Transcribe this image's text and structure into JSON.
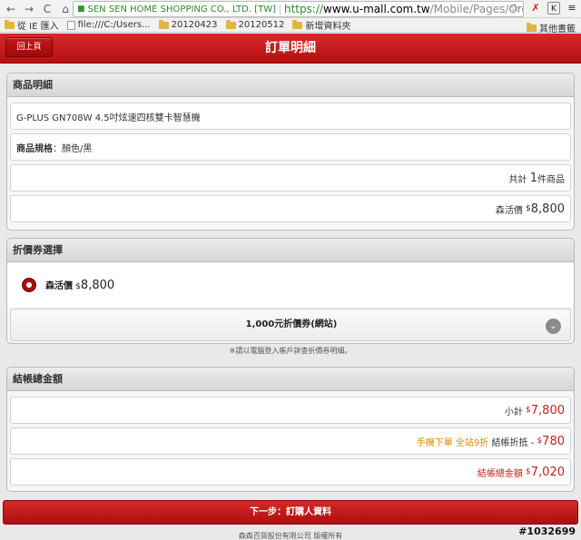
{
  "browser": {
    "ev_badge": "SEN SEN HOME SHOPPING CO., LTD. [TW]",
    "url_scheme": "https://",
    "url_host": "www.u-mall.com.tw",
    "url_path": "/Mobile/Pages/Order/FastS",
    "bookmarks": [
      {
        "label": "從 IE 匯入",
        "icon": "folder-icon"
      },
      {
        "label": "file:///C:/Users...",
        "icon": "page-icon"
      },
      {
        "label": "20120423",
        "icon": "folder-icon"
      },
      {
        "label": "20120512",
        "icon": "folder-icon"
      },
      {
        "label": "新增資料夾",
        "icon": "folder-icon"
      }
    ],
    "other_bookmarks": "其他書籤"
  },
  "header": {
    "back_label": "回上頁",
    "title": "訂單明細"
  },
  "product_panel": {
    "title": "商品明細",
    "product_name": "G-PLUS GN708W 4.5吋炫速四核雙卡智慧機",
    "spec_label": "商品規格",
    "spec_value": "：顏色/黑",
    "qty_prefix": "共計",
    "qty_value": "1",
    "qty_suffix": "件商品",
    "price_label": "森活價",
    "price_currency": "$",
    "price_value": "8,800"
  },
  "coupon_panel": {
    "title": "折價券選擇",
    "option_label": "森活價",
    "option_currency": "$",
    "option_value": "8,800",
    "coupon_label": "1,000元折價券(網站)",
    "note": "※請以電腦登入帳戶詳查折價券明細。"
  },
  "total_panel": {
    "title": "結帳總金額",
    "subtotal_label": "小計",
    "subtotal_currency": "$",
    "subtotal_value": "7,800",
    "discount_promo": "手機下單 全站9折",
    "discount_label": "結帳折抵 -",
    "discount_currency": "$",
    "discount_value": "780",
    "total_label": "結帳總金額",
    "total_currency": "$",
    "total_value": "7,020"
  },
  "next_button": "下一步：訂購人資料",
  "footer": "森森百貨股份有限公司 版權所有",
  "watermark": "#1032699",
  "colors": {
    "brand_red": "#c62020",
    "promo_orange": "#e08a00"
  }
}
